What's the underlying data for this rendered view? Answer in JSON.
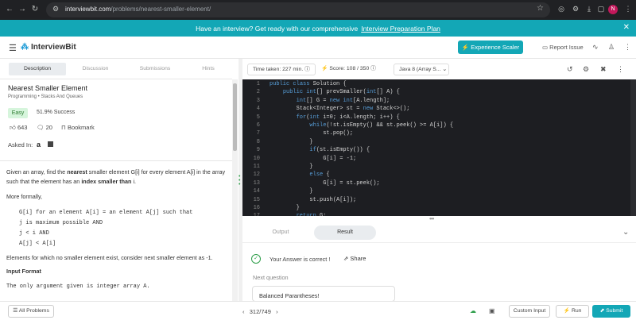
{
  "browser": {
    "url_host": "interviewbit.com",
    "url_path": "/problems/nearest-smaller-element/",
    "profile_initial": "N"
  },
  "banner": {
    "text": "Have an interview? Get ready with our comprehensive",
    "link": "Interview Preparation Plan"
  },
  "header": {
    "logo": "InterviewBit",
    "experience_button": "Experience Scaler",
    "report_issue": "Report Issue"
  },
  "left_tabs": [
    "Description",
    "Discussion",
    "Submissions",
    "Hints"
  ],
  "problem": {
    "title": "Nearest Smaller Element",
    "crumbs": "Programming • Stacks And Queues",
    "difficulty": "Easy",
    "success": "51.9% Success",
    "likes": "643",
    "comments": "20",
    "bookmark": "Bookmark",
    "asked_in": "Asked In:",
    "desc_1a": "Given an array, find the",
    "desc_1b": "nearest",
    "desc_1c": "smaller element G[i] for every element A[i] in the array such that the element has an",
    "desc_1d": "index smaller than",
    "desc_1e": "i.",
    "more_formally": "More formally,",
    "formal": [
      "G[i] for an element A[i] = an element A[j] such that",
      "j is maximum possible AND",
      "j < i AND",
      "A[j] < A[i]"
    ],
    "no_smaller": "Elements for which no smaller element exist, consider next smaller element as -1.",
    "input_format": "Input Format",
    "input_desc": "The only argument given is integer array A."
  },
  "editor": {
    "time_taken": "Time taken: 227 min.",
    "score": "Score: 108 / 350",
    "language": "Java 8 (Array S...",
    "lines": [
      "public class Solution {",
      "    public int[] prevSmaller(int[] A) {",
      "        int[] G = new int[A.length];",
      "        Stack<Integer> st = new Stack<>();",
      "        for(int i=0; i<A.length; i++) {",
      "            while(!st.isEmpty() && st.peek() >= A[i]) {",
      "                st.pop();",
      "            }",
      "            if(st.isEmpty()) {",
      "                G[i] = -1;",
      "            }",
      "            else {",
      "                G[i] = st.peek();",
      "            }",
      "            st.push(A[i]);",
      "        }",
      "        return G;",
      "    }"
    ],
    "line_numbers": [
      "1",
      "2",
      "3",
      "4",
      "5",
      "6",
      "7",
      "8",
      "9",
      "10",
      "11",
      "12",
      "13",
      "14",
      "15",
      "16",
      "17"
    ]
  },
  "output": {
    "tabs": [
      "Output",
      "Result"
    ],
    "answer": "Your Answer is correct !",
    "share": "Share",
    "next_question": "Next question",
    "next_title": "Balanced Parantheses!"
  },
  "bottom": {
    "all_problems": "All Problems",
    "page": "312/749",
    "custom_input": "Custom Input",
    "run": "Run",
    "submit": "Submit"
  }
}
